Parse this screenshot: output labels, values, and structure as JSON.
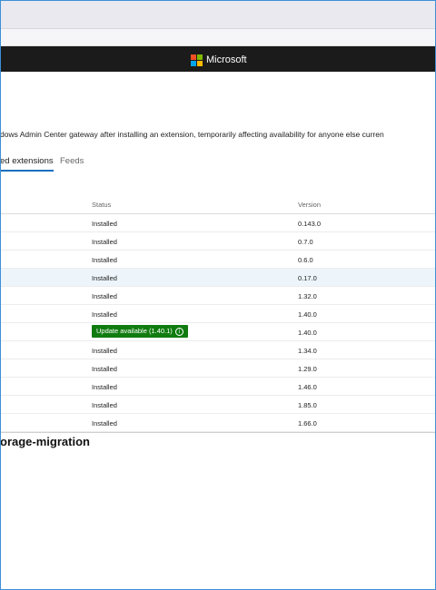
{
  "brand": {
    "name": "Microsoft",
    "logo_colors": [
      "#f25022",
      "#7fba00",
      "#00a4ef",
      "#ffb900"
    ]
  },
  "description": "dows Admin Center gateway after installing an extension, temporarily affecting availability for anyone else curren",
  "tabs": [
    {
      "label": "ed extensions",
      "active": true
    },
    {
      "label": "Feeds",
      "active": false
    }
  ],
  "table": {
    "columns": {
      "status": "Status",
      "version": "Version"
    },
    "rows": [
      {
        "status": "Installed",
        "version": "0.143.0"
      },
      {
        "status": "Installed",
        "version": "0.7.0"
      },
      {
        "status": "Installed",
        "version": "0.6.0"
      },
      {
        "status": "Installed",
        "version": "0.17.0",
        "highlighted": true
      },
      {
        "status": "Installed",
        "version": "1.32.0"
      },
      {
        "status": "Installed",
        "version": "1.40.0"
      },
      {
        "status": "Update available (1.40.1)",
        "version": "1.40.0",
        "update": true
      },
      {
        "status": "Installed",
        "version": "1.34.0"
      },
      {
        "status": "Installed",
        "version": "1.29.0"
      },
      {
        "status": "Installed",
        "version": "1.46.0"
      },
      {
        "status": "Installed",
        "version": "1.85.0"
      },
      {
        "status": "Installed",
        "version": "1.66.0"
      }
    ]
  },
  "details_title": "orage-migration",
  "colors": {
    "accent": "#1a6fbf",
    "update_badge": "#107c10",
    "topbar": "#1b1b1b"
  }
}
